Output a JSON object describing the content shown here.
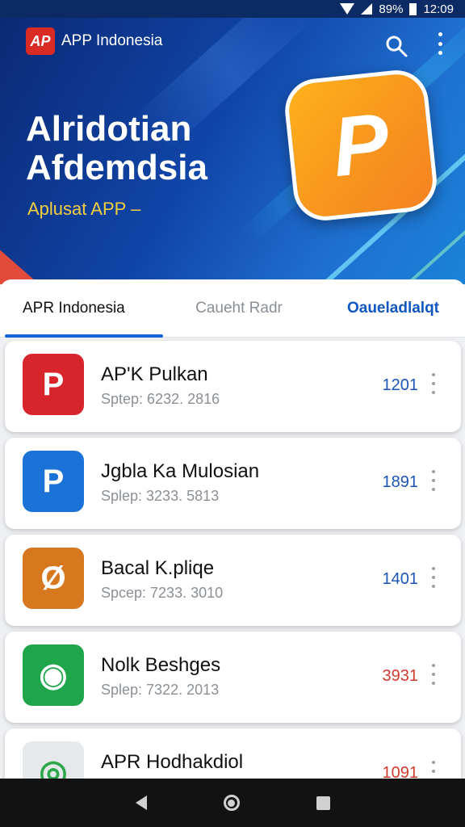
{
  "status_bar": {
    "battery": "89%",
    "time": "12:09",
    "icons": [
      "wifi-icon",
      "signal-icon",
      "battery-icon"
    ]
  },
  "header": {
    "brand_logo_text": "AP",
    "brand_name": "APP Indonesia",
    "title_line1": "Alridotian",
    "title_line2": "Afdemdsia",
    "subtitle": "Aplusat APP –",
    "hero_icon_glyph": "P"
  },
  "tabs": [
    {
      "label": "APR Indonesia",
      "active": true
    },
    {
      "label": "Caueht Radr",
      "active": false
    },
    {
      "label": "Oaueladlalqt",
      "active": false
    }
  ],
  "apps": [
    {
      "name": "AP'K Pulkan",
      "meta": "Sptep:  6232. 2816",
      "count": "1201",
      "icon_bg": "#d7252b",
      "count_color": "#1a55b8",
      "icon_glyph": "P",
      "icon_name": "apk-app-icon"
    },
    {
      "name": "Jgbla Ka Mulosian",
      "meta": "Splep:  3233. 5813",
      "count": "1891",
      "count_color": "#1a55b8",
      "icon_bg": "#1b73d8",
      "icon_glyph": "P",
      "icon_name": "play-app-icon"
    },
    {
      "name": "Bacal K.pliqe",
      "meta": "Spcep:  7233. 3010",
      "count": "1401",
      "count_color": "#1a55b8",
      "icon_bg": "#d7781f",
      "icon_glyph": "Ø",
      "icon_name": "tool-app-icon"
    },
    {
      "name": "Nolk Beshges",
      "meta": "Splep:  7322. 2013",
      "count": "3931",
      "count_color": "#d23a2e",
      "icon_bg": "#1fa64b",
      "icon_glyph": "◉",
      "icon_name": "android-app-icon"
    },
    {
      "name": "APR Hodhakdiol",
      "meta": "",
      "count": "1091",
      "count_color": "#d23a2e",
      "icon_bg": "#e6e9ec",
      "icon_glyph": "◎",
      "icon_name": "gauge-app-icon"
    }
  ],
  "colors": {
    "accent": "#1565d8",
    "hero_start": "#0b2a75",
    "hero_end": "#1a83d8",
    "orange": "#f7931e"
  }
}
